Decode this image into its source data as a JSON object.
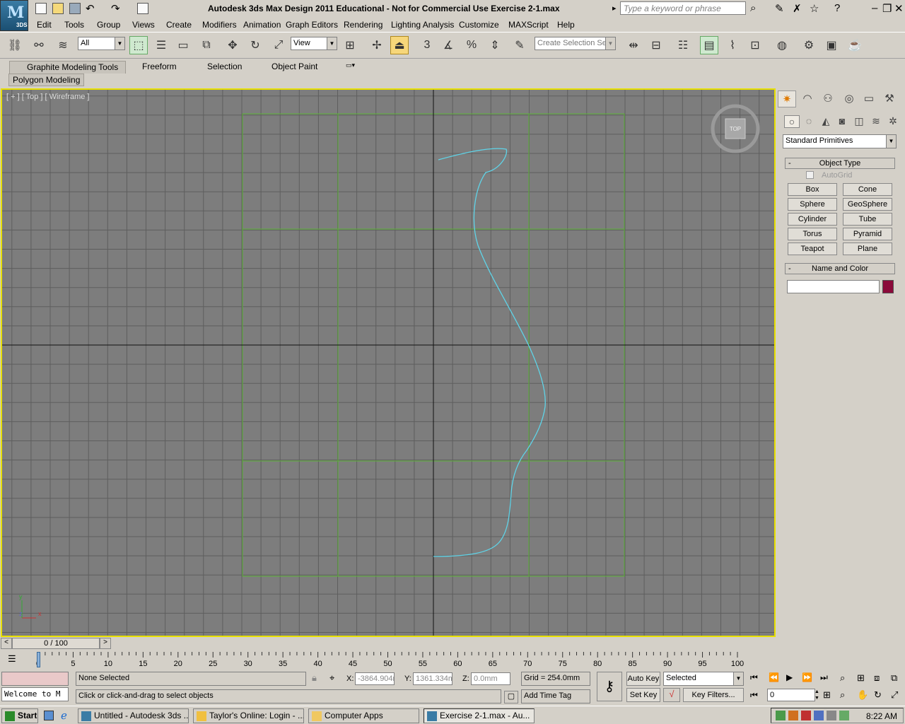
{
  "window": {
    "title": "Autodesk 3ds Max Design 2011   Educational - Not for Commercial Use   Exercise 2-1.max",
    "search_placeholder": "Type a keyword or phrase",
    "logo_text": "M",
    "logo_sub": "3DS"
  },
  "menu": [
    "Edit",
    "Tools",
    "Group",
    "Views",
    "Create",
    "Modifiers",
    "Animation",
    "Graph Editors",
    "Rendering",
    "Lighting Analysis",
    "Customize",
    "MAXScript",
    "Help"
  ],
  "toolbar": {
    "selection_filter": "All",
    "reference_coord": "View",
    "selection_set_placeholder": "Create Selection Se",
    "snap_label": "3"
  },
  "ribbon": {
    "tabs": [
      "Graphite Modeling Tools",
      "Freeform",
      "Selection",
      "Object Paint"
    ],
    "panel": "Polygon Modeling"
  },
  "viewport": {
    "label": "[ + ] [ Top ] [ Wireframe ]",
    "viewcube": "TOP",
    "axis_x": "x",
    "axis_y": "y",
    "axis_z": "z"
  },
  "command_panel": {
    "dropdown": "Standard Primitives",
    "object_type_title": "Object Type",
    "autogrid": "AutoGrid",
    "primitives": [
      "Box",
      "Cone",
      "Sphere",
      "GeoSphere",
      "Cylinder",
      "Tube",
      "Torus",
      "Pyramid",
      "Teapot",
      "Plane"
    ],
    "name_color_title": "Name and Color",
    "name_value": "",
    "object_color": "#8b0a3a"
  },
  "timeline": {
    "frame": "0 / 100",
    "ticks": [
      "0",
      "5",
      "10",
      "15",
      "20",
      "25",
      "30",
      "35",
      "40",
      "45",
      "50",
      "55",
      "60",
      "65",
      "70",
      "75",
      "80",
      "85",
      "90",
      "95",
      "100"
    ]
  },
  "status": {
    "listener": "Welcome to M",
    "selection": "None Selected",
    "prompt": "Click or click-and-drag to select objects",
    "x_label": "X:",
    "x_value": "-3864.904r",
    "y_label": "Y:",
    "y_value": "1361.334m",
    "z_label": "Z:",
    "z_value": "0.0mm",
    "grid": "Grid = 254.0mm",
    "add_time_tag": "Add Time Tag",
    "auto_key": "Auto Key",
    "set_key": "Set Key",
    "key_mode": "Selected",
    "key_filters": "Key Filters...",
    "current_frame": "0"
  },
  "taskbar": {
    "start": "Start",
    "tasks": [
      "Untitled - Autodesk 3ds ...",
      "Taylor's Online: Login - ...",
      "Computer Apps",
      "Exercise 2-1.max - Au..."
    ],
    "clock": "8:22 AM"
  }
}
